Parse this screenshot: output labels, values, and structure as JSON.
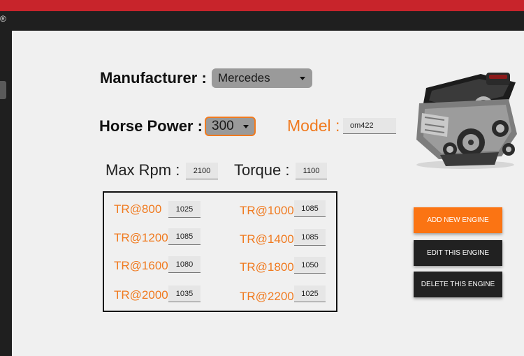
{
  "colors": {
    "top_bar": "#c8242b",
    "accent": "#f07a1f",
    "button_primary": "#fb7413",
    "button_dark": "#212121"
  },
  "window": {
    "title_mark": "®"
  },
  "manufacturer": {
    "label": "Manufacturer :",
    "value": "Mercedes"
  },
  "horse_power": {
    "label": "Horse Power :",
    "value": "300"
  },
  "model": {
    "label": "Model :",
    "value": "om422"
  },
  "max_rpm": {
    "label": "Max Rpm :",
    "value": "2100"
  },
  "torque": {
    "label": "Torque :",
    "value": "1100"
  },
  "torque_table": [
    {
      "label": "TR@800",
      "value": "1025"
    },
    {
      "label": "TR@1000",
      "value": "1085"
    },
    {
      "label": "TR@1200",
      "value": "1085"
    },
    {
      "label": "TR@1400",
      "value": "1085"
    },
    {
      "label": "TR@1600",
      "value": "1080"
    },
    {
      "label": "TR@1800",
      "value": "1050"
    },
    {
      "label": "TR@2000",
      "value": "1035"
    },
    {
      "label": "TR@2200",
      "value": "1025"
    }
  ],
  "buttons": {
    "add": "ADD NEW ENGINE",
    "edit": "EDIT THIS ENGINE",
    "delete": "DELETE THIS ENGINE"
  },
  "image": {
    "icon": "engine-image"
  }
}
